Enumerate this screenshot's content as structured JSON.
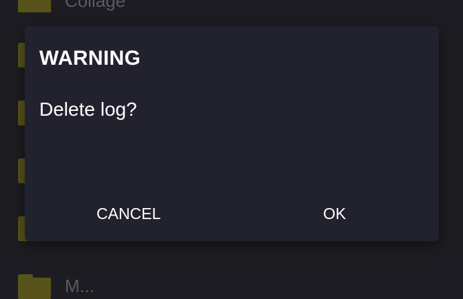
{
  "background_list": {
    "items": [
      {
        "label": "Collage"
      },
      {
        "label": ""
      },
      {
        "label": ""
      },
      {
        "label": ""
      },
      {
        "label": ""
      },
      {
        "label": "M..."
      }
    ]
  },
  "dialog": {
    "title": "WARNING",
    "message": "Delete log?",
    "cancel_label": "CANCEL",
    "ok_label": "OK"
  },
  "colors": {
    "background": "#1c1c22",
    "dialog_background": "#22222e",
    "folder": "#57531a",
    "text": "#ffffff"
  }
}
